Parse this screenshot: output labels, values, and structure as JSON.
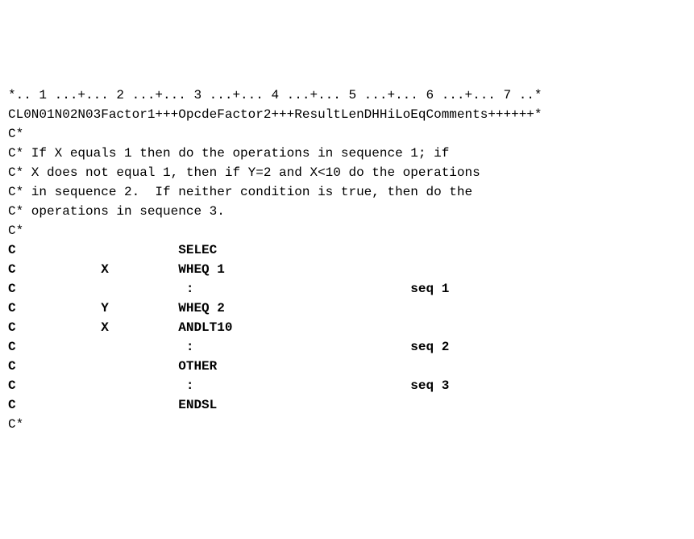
{
  "lines": [
    {
      "text": "*.. 1 ...+... 2 ...+... 3 ...+... 4 ...+... 5 ...+... 6 ...+... 7 ..*",
      "bold": false
    },
    {
      "text": "CL0N01N02N03Factor1+++OpcdeFactor2+++ResultLenDHHiLoEqComments++++++*",
      "bold": false
    },
    {
      "text": "C*",
      "bold": false
    },
    {
      "text": "C* If X equals 1 then do the operations in sequence 1; if",
      "bold": false
    },
    {
      "text": "C* X does not equal 1, then if Y=2 and X<10 do the operations",
      "bold": false
    },
    {
      "text": "C* in sequence 2.  If neither condition is true, then do the",
      "bold": false
    },
    {
      "text": "C* operations in sequence 3.",
      "bold": false
    },
    {
      "text": "C*",
      "bold": false
    },
    {
      "text": "C                     SELEC",
      "bold": true
    },
    {
      "text": "C           X         WHEQ 1",
      "bold": true
    },
    {
      "text": "C                      :                            seq 1",
      "bold": true
    },
    {
      "text": "C           Y         WHEQ 2",
      "bold": true
    },
    {
      "text": "C           X         ANDLT10",
      "bold": true
    },
    {
      "text": "C                      :                            seq 2",
      "bold": true
    },
    {
      "text": "C                     OTHER",
      "bold": true
    },
    {
      "text": "C                      :                            seq 3",
      "bold": true
    },
    {
      "text": "C                     ENDSL",
      "bold": true
    },
    {
      "text": "C*",
      "bold": false
    }
  ]
}
